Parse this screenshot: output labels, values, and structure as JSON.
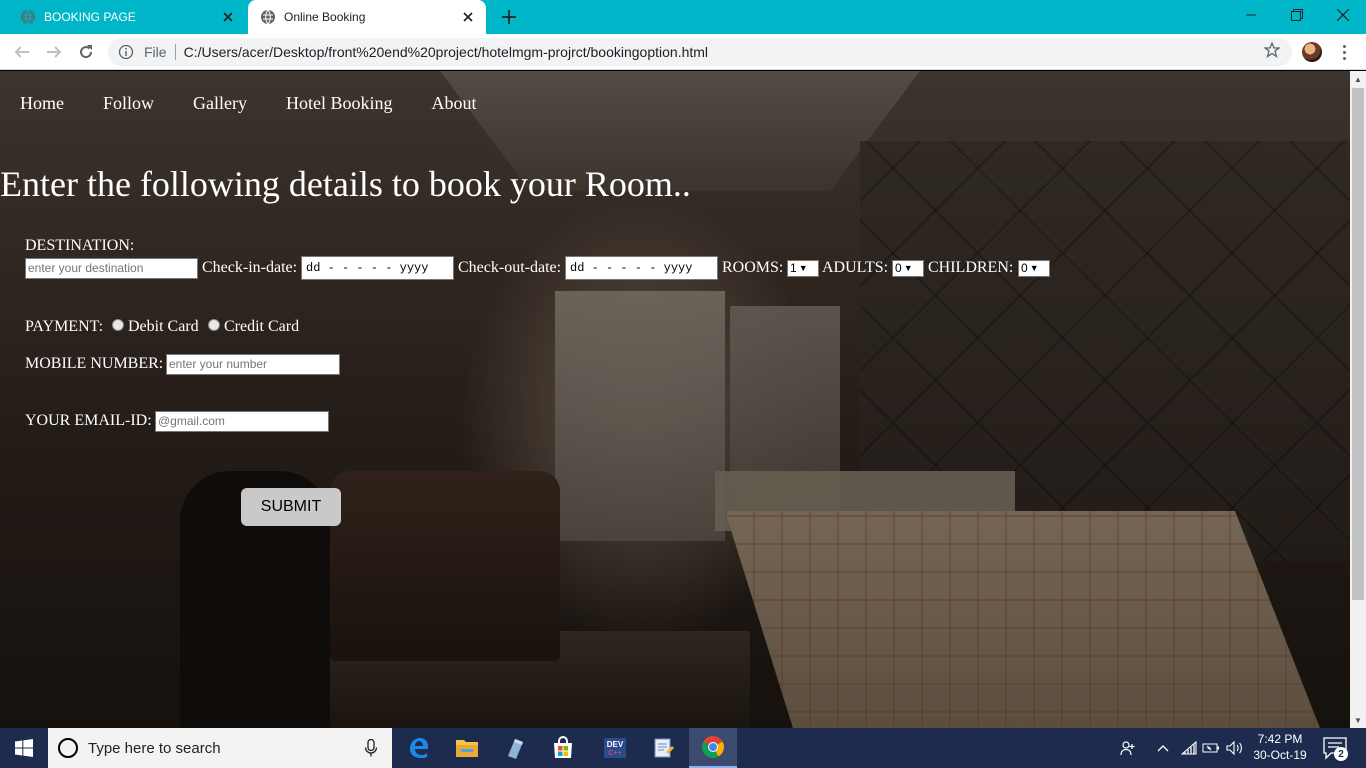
{
  "browser": {
    "tabs": [
      {
        "title": "BOOKING PAGE",
        "active": false
      },
      {
        "title": "Online Booking",
        "active": true
      }
    ],
    "omnibox": {
      "scheme_label": "File",
      "url": "C:/Users/acer/Desktop/front%20end%20project/hotelmgm-projrct/bookingoption.html"
    }
  },
  "site": {
    "nav": [
      "Home",
      "Follow",
      "Gallery",
      "Hotel Booking",
      "About"
    ],
    "headline": "Enter the following details to book your Room..",
    "form": {
      "destination_label": "DESTINATION:",
      "destination_placeholder": "enter your destination",
      "checkin_label": "Check-in-date:",
      "checkin_value": "dd - - - - - yyyy",
      "checkout_label": "Check-out-date:",
      "checkout_value": "dd - - - - - yyyy",
      "rooms_label": "ROOMS:",
      "rooms_value": "1",
      "adults_label": "ADULTS:",
      "adults_value": "0",
      "children_label": "CHILDREN:",
      "children_value": "0",
      "payment_label": "PAYMENT:",
      "payment_options": [
        "Debit Card",
        "Credit Card"
      ],
      "mobile_label": "MOBILE NUMBER:",
      "mobile_placeholder": "enter your number",
      "email_label": "YOUR EMAIL-ID:",
      "email_placeholder": "@gmail.com",
      "submit_label": "SUBMIT"
    }
  },
  "taskbar": {
    "search_placeholder": "Type here to search",
    "time": "7:42 PM",
    "date": "30-Oct-19",
    "notification_count": "2",
    "apps": [
      "edge-icon",
      "file-explorer-icon",
      "app-icon",
      "store-icon",
      "devcpp-icon",
      "notepad-icon",
      "chrome-icon"
    ]
  },
  "colors": {
    "tabbar": "#00b7c9",
    "taskbar": "#1d2b4f",
    "submit_button": "#c9c9c9"
  }
}
